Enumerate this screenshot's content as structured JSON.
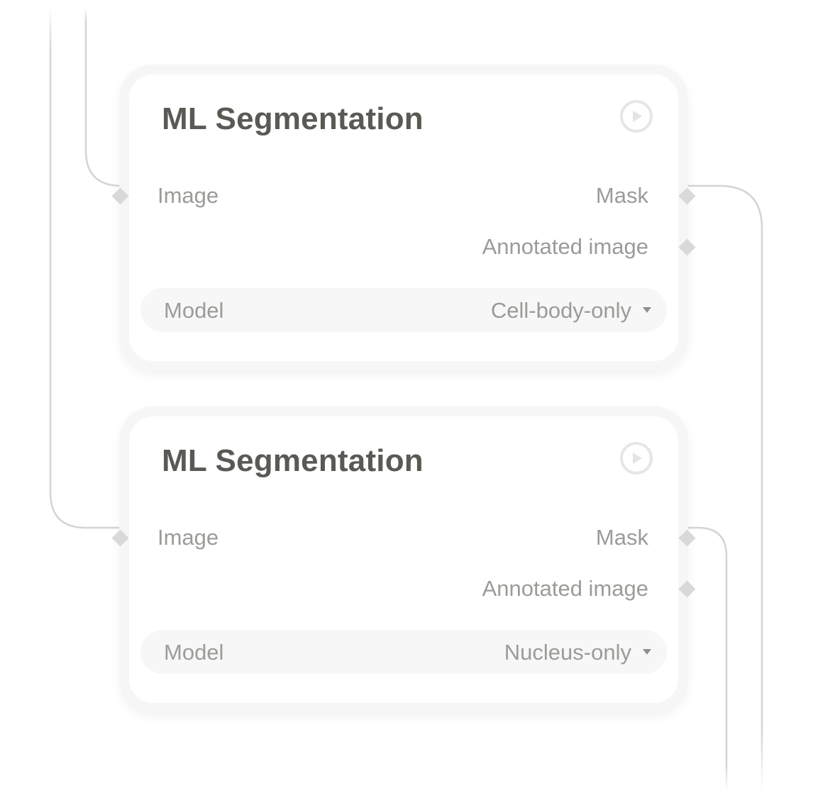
{
  "nodes": [
    {
      "title": "ML Segmentation",
      "run_icon": "play-circle-icon",
      "inputs": [
        {
          "label": "Image"
        }
      ],
      "outputs": [
        {
          "label": "Mask"
        },
        {
          "label": "Annotated image"
        }
      ],
      "param": {
        "label": "Model",
        "value": "Cell-body-only",
        "icon": "caret-down-icon"
      }
    },
    {
      "title": "ML Segmentation",
      "run_icon": "play-circle-icon",
      "inputs": [
        {
          "label": "Image"
        }
      ],
      "outputs": [
        {
          "label": "Mask"
        },
        {
          "label": "Annotated image"
        }
      ],
      "param": {
        "label": "Model",
        "value": "Nucleus-only",
        "icon": "caret-down-icon"
      }
    }
  ],
  "colors": {
    "title": "#5a5a55",
    "label": "#9b9b98",
    "port": "#d9d9d9",
    "wire": "#d4d4d4",
    "node_border": "#f6f6f6"
  }
}
